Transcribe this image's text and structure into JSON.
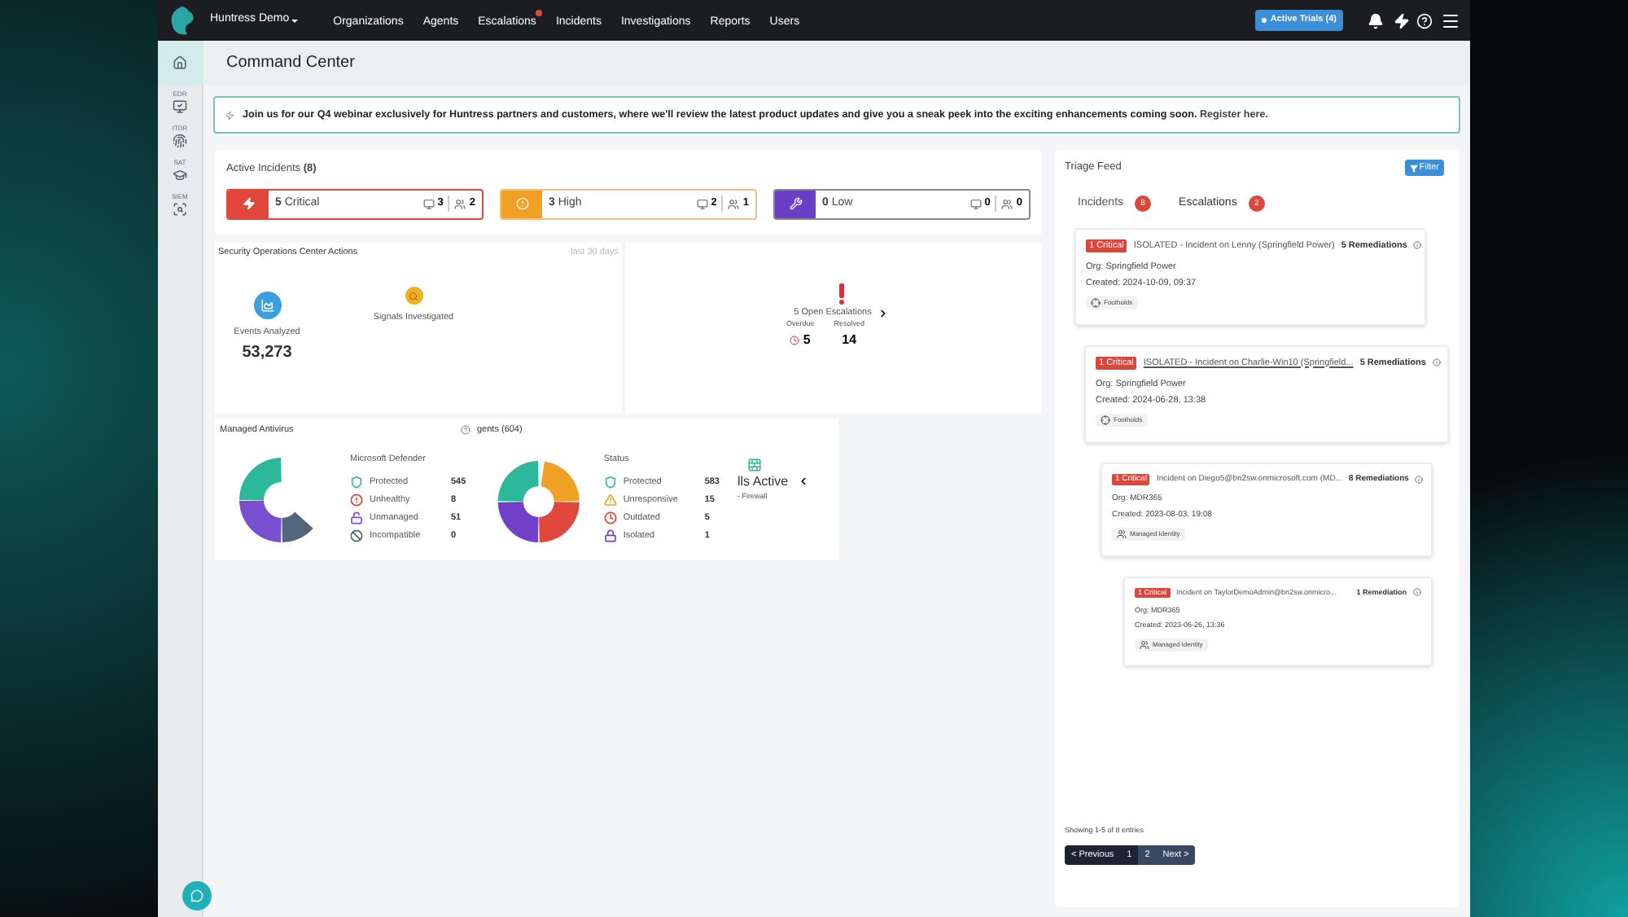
{
  "nav": {
    "brand": "Huntress Demo",
    "links": [
      {
        "label": "Organizations",
        "alert": false
      },
      {
        "label": "Agents",
        "alert": false
      },
      {
        "label": "Escalations",
        "alert": true
      },
      {
        "label": "Incidents",
        "alert": false
      },
      {
        "label": "Investigations",
        "alert": false
      },
      {
        "label": "Reports",
        "alert": false
      },
      {
        "label": "Users",
        "alert": false
      }
    ],
    "trial_button": "Active Trials (4)"
  },
  "sidebar": {
    "items": [
      {
        "kind": "home",
        "selected": true
      },
      {
        "label": "EDR",
        "kind": "edr",
        "selected": false
      },
      {
        "label": "ITDR",
        "kind": "itdr",
        "selected": false
      },
      {
        "label": "SAT",
        "kind": "sat",
        "selected": false
      },
      {
        "label": "SIEM",
        "kind": "siem",
        "selected": false
      }
    ]
  },
  "page_title": "Command Center",
  "banner": {
    "text": "Join us for our Q4 webinar exclusively for Huntress partners and customers, where we'll review the latest product updates and give you a sneak peek into the exciting enhancements coming soon.",
    "link": "Register here."
  },
  "active_incidents": {
    "title": "Active Incidents **(8)**",
    "cards": [
      {
        "kind": "critical",
        "label": "**5** Critical",
        "hosts": "3",
        "users": "2"
      },
      {
        "kind": "high",
        "label": "**3** High",
        "hosts": "2",
        "users": "1"
      },
      {
        "kind": "low",
        "label": "**0** Low",
        "hosts": "0",
        "users": "0"
      }
    ]
  },
  "soc_actions": {
    "title": "Security Operations Center Actions",
    "period": "last 30 days",
    "metrics": [
      {
        "kind": "events",
        "label": "Events Analyzed",
        "value": "53,273"
      },
      {
        "kind": "signals",
        "label": "Signals Investigated"
      }
    ]
  },
  "escalations": {
    "summary": "5 Open Escalations",
    "overdue_label": "Overdue",
    "overdue": "5",
    "resolved_label": "Resolved",
    "resolved": "14"
  },
  "antivirus": {
    "title": "Managed Antivirus",
    "subtitle": "Microsoft Defender",
    "items": [
      {
        "kind": "shield",
        "label": "Protected",
        "value": "545",
        "color": "#2bb89b"
      },
      {
        "kind": "alert",
        "label": "Unhealthy",
        "value": "8",
        "color": "#e0483c"
      },
      {
        "kind": "unlocked",
        "label": "Unmanaged",
        "value": "51",
        "color": "#7a4fd0"
      },
      {
        "kind": "block",
        "label": "Incompatible",
        "value": "0",
        "color": "#52667e"
      }
    ]
  },
  "agents": {
    "title": "gents (604)",
    "subtitle": "Status",
    "items": [
      {
        "kind": "shield",
        "label": "Protected",
        "value": "583",
        "color": "#2bb89b"
      },
      {
        "kind": "warning",
        "label": "Unresponsive",
        "value": "15",
        "color": "#f0a024"
      },
      {
        "kind": "clock",
        "label": "Outdated",
        "value": "5",
        "color": "#e0483c"
      },
      {
        "kind": "lock",
        "label": "Isolated",
        "value": "1",
        "color": "#7040c8"
      }
    ]
  },
  "firewall": {
    "title": "lls Active",
    "subtitle": "- Firewall"
  },
  "triage": {
    "title": "Triage Feed",
    "filter": "Filter",
    "tabs": [
      {
        "label": "Incidents",
        "count": "8",
        "selected": true
      },
      {
        "label": "Escalations",
        "count": "2",
        "selected": false
      }
    ],
    "incidents": [
      {
        "badge": "1 Critical",
        "title": "ISOLATED - Incident on Lenny (Springfield Power)",
        "hovered": false,
        "remediations": "5 Remediations",
        "org": "Org: Springfield Power",
        "created": "Created: 2024-10-09, 09:37",
        "tag": {
          "kind": "foothold",
          "label": "Footholds"
        }
      },
      {
        "badge": "1 Critical",
        "title": "ISOLATED - Incident on Charlie-Win10 (Springfield...",
        "hovered": true,
        "remediations": "5 Remediations",
        "org": "Org: Springfield Power",
        "created": "Created: 2024-06-28, 13:38",
        "tag": {
          "kind": "foothold",
          "label": "Footholds"
        }
      },
      {
        "badge": "1 Critical",
        "title": "Incident on Diego5@bn2sw.onmicrosoft.com (MD...",
        "hovered": false,
        "remediations": "8 Remediations",
        "org": "Org: MDR365",
        "created": "Created: 2023-08-03, 19:08",
        "tag": {
          "kind": "identity",
          "label": "Managed Identity"
        }
      },
      {
        "badge": "1 Critical",
        "title": "Incident on TaylorDemoAdmin@bn2sw.onmicro...",
        "hovered": false,
        "remediations": "1 Remediation",
        "org": "Org: MDR365",
        "created": "Created: 2023-06-26, 13:36",
        "tag": {
          "kind": "identity",
          "label": "Managed Identity"
        }
      }
    ],
    "showing": "Showing 1-5 of 8 entries",
    "previous": "< Previous",
    "pages": [
      {
        "label": "1",
        "selected": true
      },
      {
        "label": "2",
        "selected": false
      }
    ],
    "next": "Next >"
  }
}
